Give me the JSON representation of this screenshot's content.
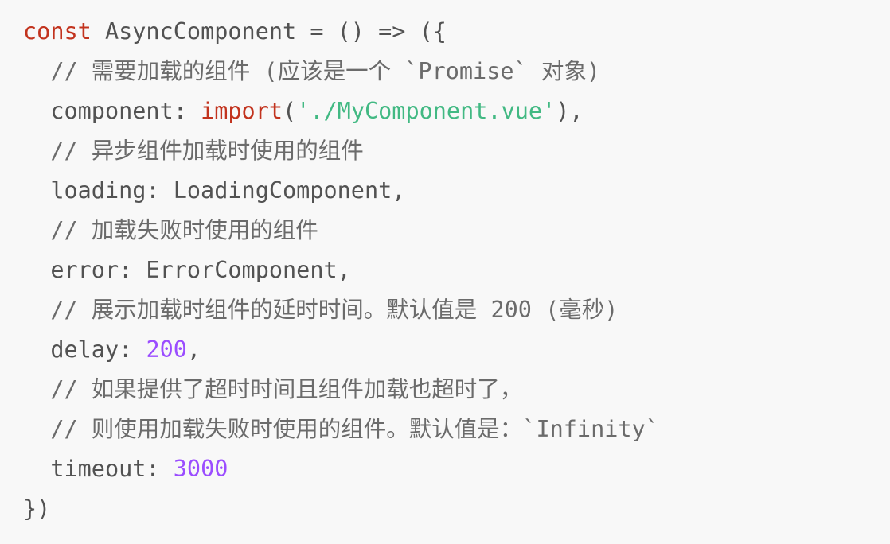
{
  "colors": {
    "keyword": "#c2331e",
    "string": "#42b983",
    "number": "#9b4dff",
    "comment": "#6b6b6b",
    "text": "#525252",
    "background": "#f8f8f8"
  },
  "code": {
    "lines": [
      [
        {
          "t": "kw",
          "v": "const"
        },
        {
          "t": "tx",
          "v": " AsyncComponent = () => ({"
        }
      ],
      [
        {
          "t": "cm",
          "v": "  // 需要加载的组件 (应该是一个 `Promise` 对象)"
        }
      ],
      [
        {
          "t": "tx",
          "v": "  component: "
        },
        {
          "t": "kw",
          "v": "import"
        },
        {
          "t": "tx",
          "v": "("
        },
        {
          "t": "str",
          "v": "'./MyComponent.vue'"
        },
        {
          "t": "tx",
          "v": "),"
        }
      ],
      [
        {
          "t": "cm",
          "v": "  // 异步组件加载时使用的组件"
        }
      ],
      [
        {
          "t": "tx",
          "v": "  loading: LoadingComponent,"
        }
      ],
      [
        {
          "t": "cm",
          "v": "  // 加载失败时使用的组件"
        }
      ],
      [
        {
          "t": "tx",
          "v": "  error: ErrorComponent,"
        }
      ],
      [
        {
          "t": "cm",
          "v": "  // 展示加载时组件的延时时间。默认值是 200 (毫秒)"
        }
      ],
      [
        {
          "t": "tx",
          "v": "  delay: "
        },
        {
          "t": "num",
          "v": "200"
        },
        {
          "t": "tx",
          "v": ","
        }
      ],
      [
        {
          "t": "cm",
          "v": "  // 如果提供了超时时间且组件加载也超时了，"
        }
      ],
      [
        {
          "t": "cm",
          "v": "  // 则使用加载失败时使用的组件。默认值是：`Infinity`"
        }
      ],
      [
        {
          "t": "tx",
          "v": "  timeout: "
        },
        {
          "t": "num",
          "v": "3000"
        }
      ],
      [
        {
          "t": "tx",
          "v": "})"
        }
      ]
    ]
  }
}
